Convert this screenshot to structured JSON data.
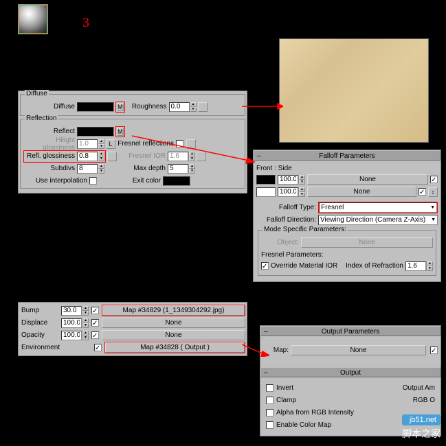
{
  "annotation_number": "3",
  "diffuse": {
    "title": "Diffuse",
    "label": "Diffuse",
    "m": "M",
    "roughness_label": "Roughness",
    "roughness": "0.0"
  },
  "reflection": {
    "title": "Reflection",
    "reflect_label": "Reflect",
    "m": "M",
    "hilight_label": "Hilight glossiness",
    "hilight": "1.0",
    "l": "L",
    "fresnel_refl_label": "Fresnel reflections",
    "refl_gloss_label": "Refl. glossiness",
    "refl_gloss": "0.8",
    "fresnel_ior_label": "Fresnel IOR",
    "fresnel_ior": "1.6",
    "subdivs_label": "Subdivs",
    "subdivs": "8",
    "max_depth_label": "Max depth",
    "max_depth": "5",
    "use_interp_label": "Use interpolation",
    "exit_color_label": "Exit color"
  },
  "falloff": {
    "title": "Falloff Parameters",
    "front_side": "Front : Side",
    "v1": "100.0",
    "none1": "None",
    "v2": "100.0",
    "none2": "None",
    "swap": "↕",
    "type_label": "Falloff Type:",
    "type": "Fresnel",
    "dir_label": "Falloff Direction:",
    "dir": "Viewing Direction (Camera Z-Axis)",
    "mode_title": "Mode Specific Parameters:",
    "object_label": "Object:",
    "object_btn": "None",
    "fresnel_params": "Fresnel Parameters:",
    "override_label": "Override Material IOR",
    "ior_label": "Index of Refraction",
    "ior": "1.6"
  },
  "maps": {
    "bump_label": "Bump",
    "bump_v": "30.0",
    "bump_map": "Map #34829 (1_1349304292.jpg)",
    "displace_label": "Displace",
    "displace_v": "100.0",
    "displace_map": "None",
    "opacity_label": "Opacity",
    "opacity_v": "100.0",
    "opacity_map": "None",
    "env_label": "Environment",
    "env_map": "Map #34828  ( Output )"
  },
  "output": {
    "title": "Output Parameters",
    "map_label": "Map:",
    "map_btn": "None",
    "section": "Output",
    "invert": "Invert",
    "output_amt": "Output Am",
    "clamp": "Clamp",
    "rgb_o": "RGB O",
    "alpha": "Alpha from RGB Intensity",
    "enable_cmap": "Enable Color Map"
  },
  "watermark": {
    "url": "jb51.net",
    "cn": "脚本之家"
  }
}
